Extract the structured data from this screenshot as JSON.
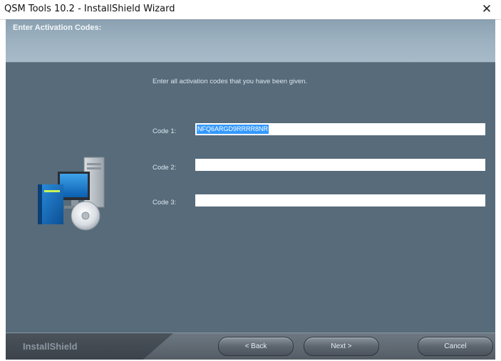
{
  "window": {
    "title": "QSM Tools 10.2 - InstallShield Wizard",
    "close_glyph": "✕"
  },
  "header": {
    "heading": "Enter Activation Codes:"
  },
  "main": {
    "instruction": "Enter all activation codes that you have been given.",
    "fields": [
      {
        "label": "Code 1:",
        "value": "NFQ6ARGD9RRRR8NR",
        "selected": true
      },
      {
        "label": "Code 2:",
        "value": ""
      },
      {
        "label": "Code 3:",
        "value": ""
      }
    ]
  },
  "footer": {
    "brand": "InstallShield",
    "back_label": "< Back",
    "next_label": "Next >",
    "cancel_label": "Cancel"
  },
  "icons": {
    "setup_art": "computer-and-disc-icon",
    "close": "close-icon"
  }
}
